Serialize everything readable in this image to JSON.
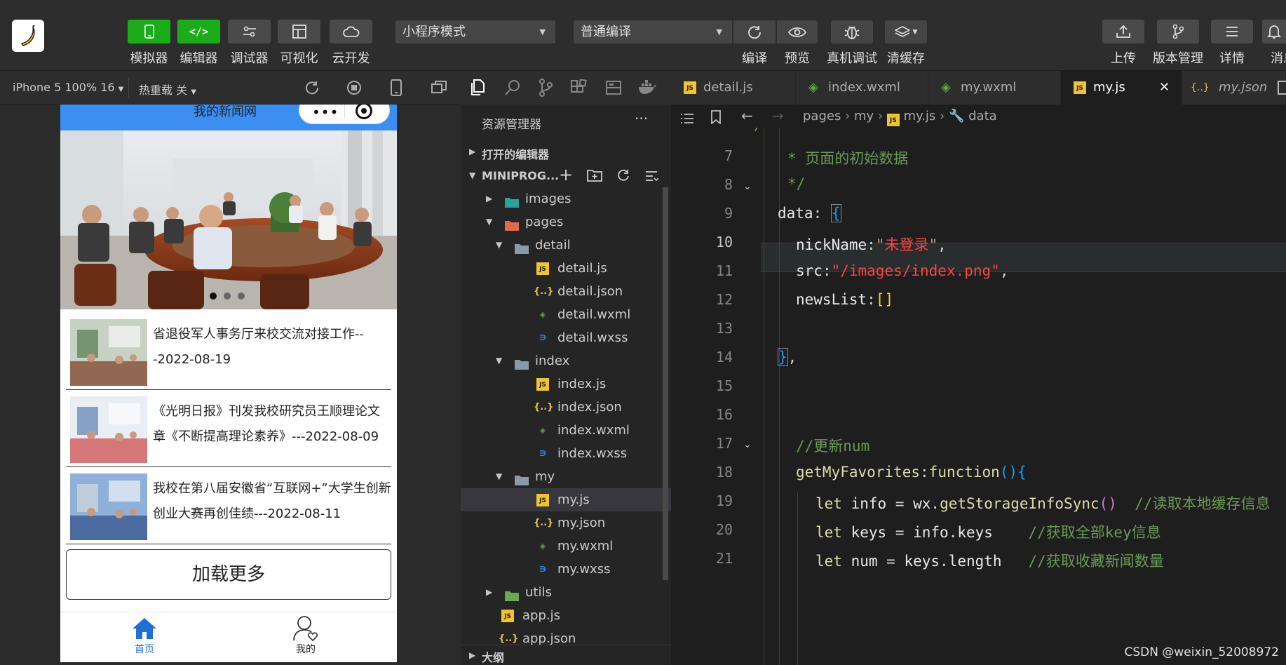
{
  "toolbar": {
    "left_buttons": [
      {
        "label": "模拟器",
        "icon": "phone-icon"
      },
      {
        "label": "编辑器",
        "icon": "code-icon"
      },
      {
        "label": "调试器",
        "icon": "debug-icon"
      },
      {
        "label": "可视化",
        "icon": "layout-icon"
      },
      {
        "label": "云开发",
        "icon": "cloud-icon"
      }
    ],
    "mode_select": "小程序模式",
    "compile_select": "普通编译",
    "mid_buttons": [
      {
        "label": "编译",
        "icon": "refresh-icon"
      },
      {
        "label": "预览",
        "icon": "eye-icon"
      },
      {
        "label": "真机调试",
        "icon": "bug-icon"
      },
      {
        "label": "清缓存",
        "icon": "layers-icon"
      }
    ],
    "right_buttons": [
      {
        "label": "上传",
        "icon": "upload-icon"
      },
      {
        "label": "版本管理",
        "icon": "branch-icon"
      },
      {
        "label": "详情",
        "icon": "menu-icon"
      },
      {
        "label": "消息",
        "icon": "bell-icon"
      }
    ]
  },
  "simulator": {
    "device": "iPhone 5 100% 16",
    "hot_reload": "热重载 关",
    "page_title": "我的新闻网",
    "news": [
      {
        "title": "省退役军人事务厅来校交流对接工作---2022-08-19"
      },
      {
        "title": "《光明日报》刊发我校研究员王顺理论文章《不断提高理论素养》---2022-08-09"
      },
      {
        "title": "我校在第八届安徽省“互联网+”大学生创新创业大赛再创佳绩---2022-08-11"
      }
    ],
    "load_more": "加载更多",
    "tabbar": [
      {
        "label": "首页",
        "active": true
      },
      {
        "label": "我的",
        "active": false
      }
    ],
    "colors": {
      "nav": "#3b8ff0",
      "active_tab": "#1f6fd6"
    }
  },
  "explorer": {
    "title": "资源管理器",
    "more": "···",
    "open_editors": "打开的编辑器",
    "project": "MINIPROG...",
    "tree": [
      {
        "name": "images",
        "type": "folder-images",
        "depth": 1,
        "open": false
      },
      {
        "name": "pages",
        "type": "folder-pages",
        "depth": 1,
        "open": true
      },
      {
        "name": "detail",
        "type": "folder",
        "depth": 2,
        "open": true
      },
      {
        "name": "detail.js",
        "type": "js",
        "depth": 3
      },
      {
        "name": "detail.json",
        "type": "json",
        "depth": 3
      },
      {
        "name": "detail.wxml",
        "type": "wxml",
        "depth": 3
      },
      {
        "name": "detail.wxss",
        "type": "wxss",
        "depth": 3
      },
      {
        "name": "index",
        "type": "folder",
        "depth": 2,
        "open": true
      },
      {
        "name": "index.js",
        "type": "js",
        "depth": 3
      },
      {
        "name": "index.json",
        "type": "json",
        "depth": 3
      },
      {
        "name": "index.wxml",
        "type": "wxml",
        "depth": 3
      },
      {
        "name": "index.wxss",
        "type": "wxss",
        "depth": 3
      },
      {
        "name": "my",
        "type": "folder",
        "depth": 2,
        "open": true
      },
      {
        "name": "my.js",
        "type": "js",
        "depth": 3,
        "selected": true
      },
      {
        "name": "my.json",
        "type": "json",
        "depth": 3
      },
      {
        "name": "my.wxml",
        "type": "wxml",
        "depth": 3
      },
      {
        "name": "my.wxss",
        "type": "wxss",
        "depth": 3
      },
      {
        "name": "utils",
        "type": "folder-utils",
        "depth": 1,
        "open": false
      },
      {
        "name": "app.js",
        "type": "js",
        "depth": 1
      },
      {
        "name": "app.json",
        "type": "json",
        "depth": 1
      }
    ],
    "outline": "大纲"
  },
  "editor": {
    "tabs": [
      {
        "label": "detail.js",
        "type": "js",
        "active": false
      },
      {
        "label": "index.wxml",
        "type": "wxml",
        "active": false
      },
      {
        "label": "my.wxml",
        "type": "wxml",
        "active": false
      },
      {
        "label": "my.js",
        "type": "js",
        "active": true
      },
      {
        "label": "my.json",
        "type": "json",
        "active": false
      }
    ],
    "close": "✕",
    "breadcrumb": [
      "pages",
      "my",
      "my.js",
      "data"
    ],
    "lines": [
      "7",
      "8",
      "9",
      "10",
      "11",
      "12",
      "13",
      "14",
      "15",
      "16",
      "17",
      "18",
      "19",
      "20",
      "21"
    ],
    "current_line": "10"
  },
  "watermark": "CSDN @weixin_52008972"
}
